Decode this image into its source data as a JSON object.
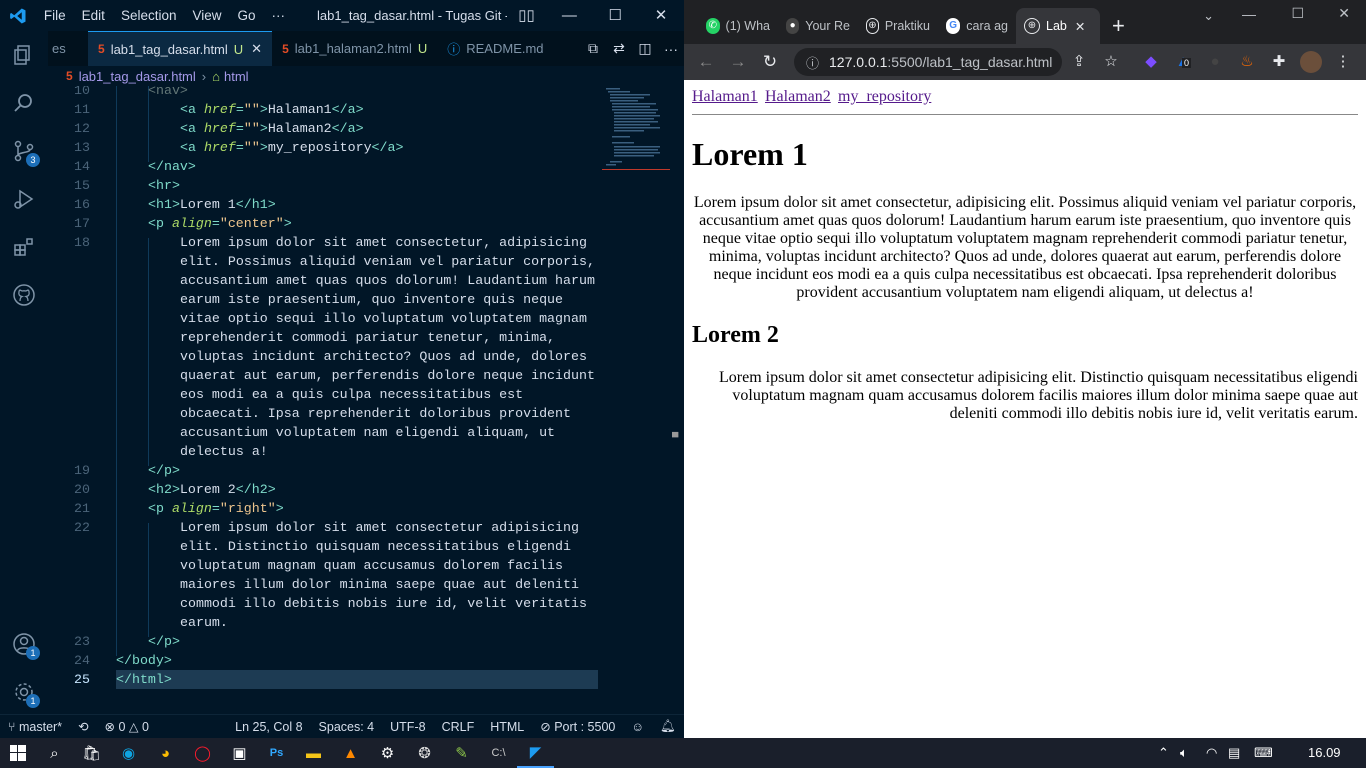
{
  "vscode": {
    "menu": [
      "File",
      "Edit",
      "Selection",
      "View",
      "Go",
      "···"
    ],
    "window_title": "lab1_tag_dasar.html - Tugas Git - ...",
    "tabs": [
      {
        "label": "es"
      },
      {
        "label": "lab1_tag_dasar.html",
        "status": "U"
      },
      {
        "label": "lab1_halaman2.html",
        "status": "U"
      },
      {
        "label": "README.md"
      }
    ],
    "breadcrumb": [
      "lab1_tag_dasar.html",
      "html"
    ],
    "activity_badges": {
      "source_control": "3",
      "accounts": "1",
      "settings": "1"
    },
    "code_lines": [
      {
        "num": "10",
        "indent": 1,
        "parts": [
          {
            "t": "<nav>",
            "c": "dim"
          }
        ]
      },
      {
        "num": "11",
        "indent": 2,
        "parts": [
          {
            "t": "<a ",
            "c": "tag"
          },
          {
            "t": "href",
            "c": "attr"
          },
          {
            "t": "=",
            "c": "tag"
          },
          {
            "t": "\"\"",
            "c": "str"
          },
          {
            "t": ">",
            "c": "tag"
          },
          {
            "t": "Halaman1",
            "c": "txt"
          },
          {
            "t": "</a>",
            "c": "tag"
          }
        ]
      },
      {
        "num": "12",
        "indent": 2,
        "parts": [
          {
            "t": "<a ",
            "c": "tag"
          },
          {
            "t": "href",
            "c": "attr"
          },
          {
            "t": "=",
            "c": "tag"
          },
          {
            "t": "\"\"",
            "c": "str"
          },
          {
            "t": ">",
            "c": "tag"
          },
          {
            "t": "Halaman2",
            "c": "txt"
          },
          {
            "t": "</a>",
            "c": "tag"
          }
        ]
      },
      {
        "num": "13",
        "indent": 2,
        "parts": [
          {
            "t": "<a ",
            "c": "tag"
          },
          {
            "t": "href",
            "c": "attr"
          },
          {
            "t": "=",
            "c": "tag"
          },
          {
            "t": "\"\"",
            "c": "str"
          },
          {
            "t": ">",
            "c": "tag"
          },
          {
            "t": "my_repository",
            "c": "txt"
          },
          {
            "t": "</a>",
            "c": "tag"
          }
        ]
      },
      {
        "num": "14",
        "indent": 1,
        "parts": [
          {
            "t": "</nav>",
            "c": "tag"
          }
        ]
      },
      {
        "num": "15",
        "indent": 1,
        "parts": [
          {
            "t": "<hr>",
            "c": "tag"
          }
        ]
      },
      {
        "num": "16",
        "indent": 1,
        "parts": [
          {
            "t": "<h1>",
            "c": "tag"
          },
          {
            "t": "Lorem 1",
            "c": "txt"
          },
          {
            "t": "</h1>",
            "c": "tag"
          }
        ]
      },
      {
        "num": "17",
        "indent": 1,
        "parts": [
          {
            "t": "<p ",
            "c": "tag"
          },
          {
            "t": "align",
            "c": "attr"
          },
          {
            "t": "=",
            "c": "tag"
          },
          {
            "t": "\"center\"",
            "c": "str"
          },
          {
            "t": ">",
            "c": "tag"
          }
        ]
      },
      {
        "num": "18",
        "indent": 2,
        "parts": [
          {
            "t": "Lorem ipsum dolor sit amet consectetur, adipisicing",
            "c": "txt"
          }
        ]
      },
      {
        "num": "",
        "indent": 2,
        "parts": [
          {
            "t": "elit. Possimus aliquid veniam vel pariatur corporis,",
            "c": "txt"
          }
        ]
      },
      {
        "num": "",
        "indent": 2,
        "parts": [
          {
            "t": "accusantium amet quas quos dolorum! Laudantium harum",
            "c": "txt"
          }
        ]
      },
      {
        "num": "",
        "indent": 2,
        "parts": [
          {
            "t": "earum iste praesentium, quo inventore quis neque",
            "c": "txt"
          }
        ]
      },
      {
        "num": "",
        "indent": 2,
        "parts": [
          {
            "t": "vitae optio sequi illo voluptatum voluptatem magnam",
            "c": "txt"
          }
        ]
      },
      {
        "num": "",
        "indent": 2,
        "parts": [
          {
            "t": "reprehenderit commodi pariatur tenetur, minima,",
            "c": "txt"
          }
        ]
      },
      {
        "num": "",
        "indent": 2,
        "parts": [
          {
            "t": "voluptas incidunt architecto? Quos ad unde, dolores",
            "c": "txt"
          }
        ]
      },
      {
        "num": "",
        "indent": 2,
        "parts": [
          {
            "t": "quaerat aut earum, perferendis dolore neque incidunt",
            "c": "txt"
          }
        ]
      },
      {
        "num": "",
        "indent": 2,
        "parts": [
          {
            "t": "eos modi ea a quis culpa necessitatibus est",
            "c": "txt"
          }
        ]
      },
      {
        "num": "",
        "indent": 2,
        "parts": [
          {
            "t": "obcaecati. Ipsa reprehenderit doloribus provident",
            "c": "txt"
          }
        ]
      },
      {
        "num": "",
        "indent": 2,
        "parts": [
          {
            "t": "accusantium voluptatem nam eligendi aliquam, ut",
            "c": "txt"
          }
        ]
      },
      {
        "num": "",
        "indent": 2,
        "parts": [
          {
            "t": "delectus a!",
            "c": "txt"
          }
        ]
      },
      {
        "num": "19",
        "indent": 1,
        "parts": [
          {
            "t": "</p>",
            "c": "tag"
          }
        ]
      },
      {
        "num": "20",
        "indent": 1,
        "parts": [
          {
            "t": "<h2>",
            "c": "tag"
          },
          {
            "t": "Lorem 2",
            "c": "txt"
          },
          {
            "t": "</h2>",
            "c": "tag"
          }
        ]
      },
      {
        "num": "21",
        "indent": 1,
        "parts": [
          {
            "t": "<p ",
            "c": "tag"
          },
          {
            "t": "align",
            "c": "attr"
          },
          {
            "t": "=",
            "c": "tag"
          },
          {
            "t": "\"right\"",
            "c": "str"
          },
          {
            "t": ">",
            "c": "tag"
          }
        ]
      },
      {
        "num": "22",
        "indent": 2,
        "parts": [
          {
            "t": "Lorem ipsum dolor sit amet consectetur adipisicing",
            "c": "txt"
          }
        ]
      },
      {
        "num": "",
        "indent": 2,
        "parts": [
          {
            "t": "elit. Distinctio quisquam necessitatibus eligendi",
            "c": "txt"
          }
        ]
      },
      {
        "num": "",
        "indent": 2,
        "parts": [
          {
            "t": "voluptatum magnam quam accusamus dolorem facilis",
            "c": "txt"
          }
        ]
      },
      {
        "num": "",
        "indent": 2,
        "parts": [
          {
            "t": "maiores illum dolor minima saepe quae aut deleniti",
            "c": "txt"
          }
        ]
      },
      {
        "num": "",
        "indent": 2,
        "parts": [
          {
            "t": "commodi illo debitis nobis iure id, velit veritatis",
            "c": "txt"
          }
        ]
      },
      {
        "num": "",
        "indent": 2,
        "parts": [
          {
            "t": "earum.",
            "c": "txt"
          }
        ]
      },
      {
        "num": "23",
        "indent": 1,
        "parts": [
          {
            "t": "</p>",
            "c": "tag"
          }
        ]
      },
      {
        "num": "24",
        "indent": 0,
        "parts": [
          {
            "t": "</body>",
            "c": "tag"
          }
        ]
      },
      {
        "num": "25",
        "indent": 0,
        "current": true,
        "parts": [
          {
            "t": "</html>",
            "c": "tag"
          }
        ]
      }
    ],
    "status": {
      "branch": "master*",
      "errors": "0",
      "warnings": "0",
      "cursor": "Ln 25, Col 8",
      "spaces": "Spaces: 4",
      "encoding": "UTF-8",
      "eol": "CRLF",
      "language": "HTML",
      "port": "Port : 5500"
    }
  },
  "chrome": {
    "tabs": [
      {
        "label": "(1) Wha",
        "icon": "whatsapp"
      },
      {
        "label": "Your Re",
        "icon": "github"
      },
      {
        "label": "Praktiku",
        "icon": "globe"
      },
      {
        "label": "cara ag",
        "icon": "google"
      },
      {
        "label": "Lab",
        "icon": "globe",
        "active": true
      }
    ],
    "url_host": "127.0.0.1",
    "url_rest": ":5500/lab1_tag_dasar.html",
    "extension_badge": "0",
    "page": {
      "links": [
        "Halaman1",
        "Halaman2",
        "my_repository"
      ],
      "h1": "Lorem 1",
      "p1": "Lorem ipsum dolor sit amet consectetur, adipisicing elit. Possimus aliquid veniam vel pariatur corporis, accusantium amet quas quos dolorum! Laudantium harum earum iste praesentium, quo inventore quis neque vitae optio sequi illo voluptatum voluptatem magnam reprehenderit commodi pariatur tenetur, minima, voluptas incidunt architecto? Quos ad unde, dolores quaerat aut earum, perferendis dolore neque incidunt eos modi ea a quis culpa necessitatibus est obcaecati. Ipsa reprehenderit doloribus provident accusantium voluptatem nam eligendi aliquam, ut delectus a!",
      "h2": "Lorem 2",
      "p2": "Lorem ipsum dolor sit amet consectetur adipisicing elit. Distinctio quisquam necessitatibus eligendi voluptatum magnam quam accusamus dolorem facilis maiores illum dolor minima saepe quae aut deleniti commodi illo debitis nobis iure id, velit veritatis earum."
    }
  },
  "taskbar": {
    "clock": "16.09"
  },
  "colors": {
    "vscode_bg": "#011627",
    "accent": "#1d9bf0",
    "chrome_frame": "#202124",
    "link_visited": "#551a8b"
  }
}
